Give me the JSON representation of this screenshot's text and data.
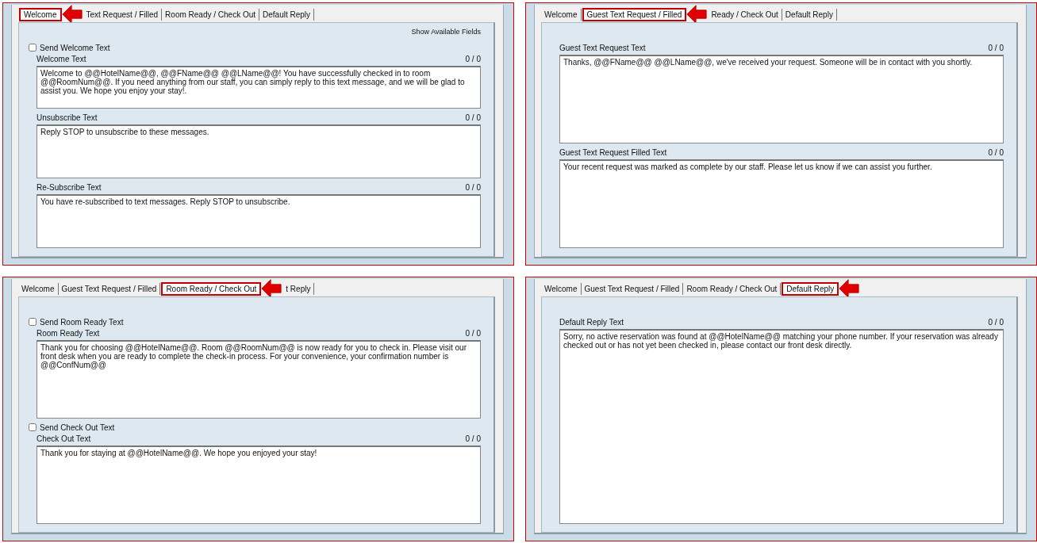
{
  "panels": [
    {
      "tabs": [
        {
          "label": "Welcome",
          "selected": true
        },
        {
          "label": "Text Request / Filled",
          "selected": false
        },
        {
          "label": "Room Ready / Check Out",
          "selected": false
        },
        {
          "label": "Default Reply",
          "selected": false
        }
      ],
      "show_fields_link": "Show Available Fields",
      "sections": [
        {
          "checkbox": {
            "label": "Send Welcome Text",
            "checked": false
          },
          "label": "Welcome Text",
          "counter": "0 / 0",
          "value": "Welcome to @@HotelName@@, @@FName@@ @@LName@@! You have successfully checked in to room @@RoomNum@@. If you need anything from our staff, you can simply reply to this text message, and we will be glad to assist you. We hope you enjoy your stay!."
        },
        {
          "label": "Unsubscribe Text",
          "counter": "0 / 0",
          "value": "Reply STOP to unsubscribe to these messages."
        },
        {
          "label": "Re-Subscribe Text",
          "counter": "0 / 0",
          "value": "You have re-subscribed to text messages. Reply STOP to unsubscribe."
        }
      ]
    },
    {
      "tabs": [
        {
          "label": "Welcome",
          "selected": false
        },
        {
          "label": "Guest Text Request / Filled",
          "selected": true
        },
        {
          "label": "Ready / Check Out",
          "selected": false
        },
        {
          "label": "Default Reply",
          "selected": false
        }
      ],
      "sections": [
        {
          "label": "Guest Text Request Text",
          "counter": "0 / 0",
          "value": "Thanks, @@FName@@ @@LName@@, we've received your request. Someone will be in contact with you shortly."
        },
        {
          "label": "Guest Text Request Filled Text",
          "counter": "0 / 0",
          "value": "Your recent request was marked as complete by our staff. Please let us know if we can assist you further."
        }
      ]
    },
    {
      "tabs": [
        {
          "label": "Welcome",
          "selected": false
        },
        {
          "label": "Guest Text Request / Filled",
          "selected": false
        },
        {
          "label": "Room Ready / Check Out",
          "selected": true
        },
        {
          "label": "t Reply",
          "selected": false
        }
      ],
      "sections": [
        {
          "checkbox": {
            "label": "Send Room Ready Text",
            "checked": false
          },
          "label": "Room Ready Text",
          "counter": "0 / 0",
          "value": "Thank you for choosing @@HotelName@@. Room @@RoomNum@@ is now ready for you to check in. Please visit our front desk when you are ready to complete the check-in process. For your convenience, your confirmation number is @@ConfNum@@"
        },
        {
          "checkbox": {
            "label": "Send Check Out Text",
            "checked": false
          },
          "label": "Check Out Text",
          "counter": "0 / 0",
          "value": "Thank you for staying at @@HotelName@@. We hope you enjoyed your stay!"
        }
      ]
    },
    {
      "tabs": [
        {
          "label": "Welcome",
          "selected": false
        },
        {
          "label": "Guest Text Request / Filled",
          "selected": false
        },
        {
          "label": "Room Ready / Check Out",
          "selected": false
        },
        {
          "label": "Default Reply",
          "selected": true
        }
      ],
      "sections": [
        {
          "label": "Default Reply Text",
          "counter": "0 / 0",
          "value": "Sorry, no active reservation was found at @@HotelName@@ matching your phone number. If your reservation was already checked out or has not yet been checked in, please contact our front desk directly."
        }
      ]
    }
  ]
}
